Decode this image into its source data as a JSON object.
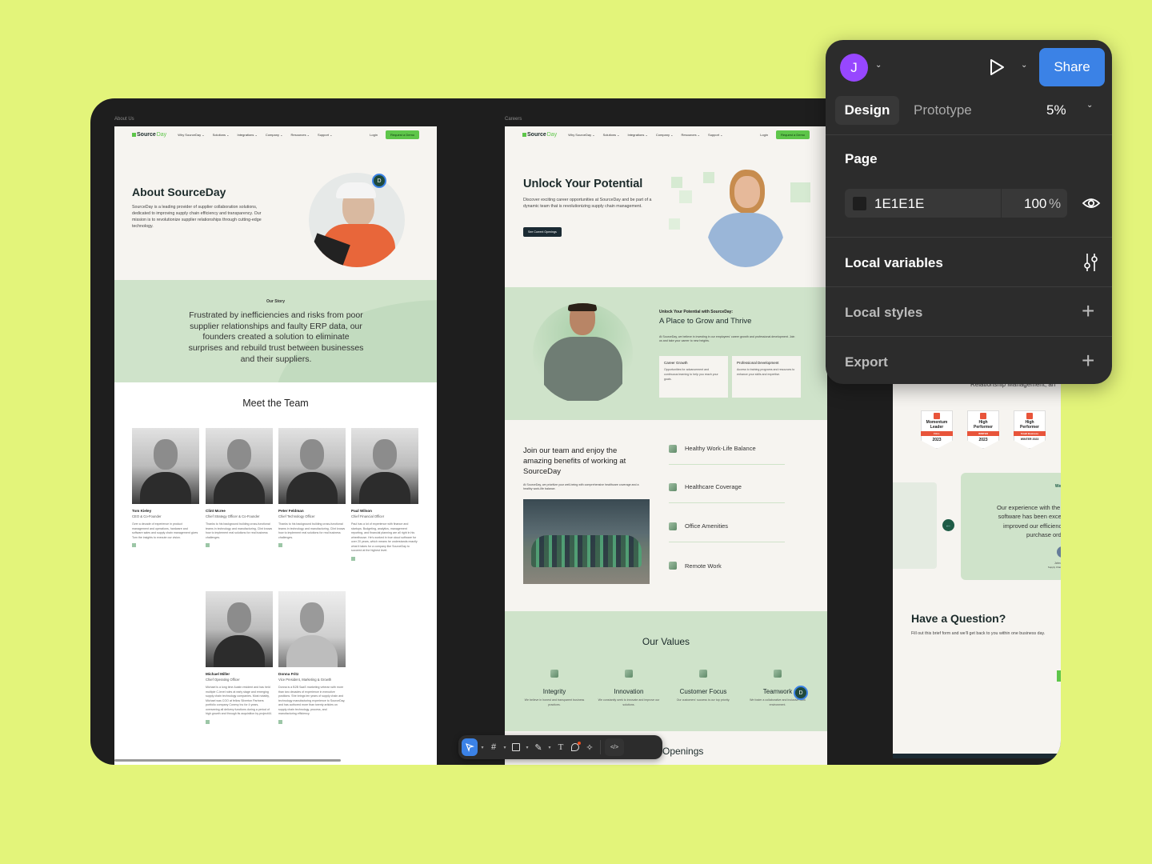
{
  "toolbar_panel": {
    "user_initial": "J",
    "share_label": "Share",
    "tabs": [
      {
        "label": "Design",
        "active": true
      },
      {
        "label": "Prototype",
        "active": false
      }
    ],
    "zoom": "5%",
    "page_section": {
      "title": "Page",
      "color_hex": "1E1E1E",
      "opacity": "100",
      "opacity_unit": "%"
    },
    "sections": [
      {
        "label": "Local variables"
      },
      {
        "label": "Local styles"
      },
      {
        "label": "Export"
      }
    ],
    "colors": {
      "share": "#3b82e6",
      "avatar": "#9747ff",
      "panel": "#2c2c2c"
    }
  },
  "frames": {
    "about": {
      "label": "About Us",
      "nav": {
        "logo_a": "Source",
        "logo_b": "Day",
        "items": [
          "Why SourceDay ⌄",
          "Solutions ⌄",
          "Integrations ⌄",
          "Company ⌄",
          "Resources ⌄",
          "Support ⌄"
        ],
        "login": "Login",
        "cta": "Request a Demo"
      },
      "hero": {
        "title": "About SourceDay",
        "body": "SourceDay is a leading provider of supplier collaboration solutions, dedicated to improving supply chain efficiency and transparency. Our mission is to revolutionize supplier relationships through cutting-edge technology."
      },
      "story": {
        "eyebrow": "Our Story",
        "body": "Frustrated by inefficiencies and risks from poor supplier relationships and faulty ERP data, our founders created a solution to eliminate surprises and rebuild trust between businesses and their suppliers."
      },
      "team": {
        "title": "Meet the Team",
        "members": [
          {
            "name": "Tom Kieley",
            "role": "CEO & Co-Founder",
            "bio": "Over a decade of experience in product management and operations, hardware and software sales and supply chain management gives Tom the insights to execute our vision."
          },
          {
            "name": "Clint Mcree",
            "role": "Chief Strategy Officer & Co-Founder",
            "bio": "Thanks to his background building cross-functional teams in technology and manufacturing, Clint knows how to implement real solutions for real business challenges."
          },
          {
            "name": "Peter Feldman",
            "role": "Chief Technology Officer",
            "bio": "Thanks to his background building cross-functional teams in technology and manufacturing, Clint knows how to implement real solutions for real business challenges."
          },
          {
            "name": "Paul Wilson",
            "role": "Chief Financial Officer",
            "bio": "Paul has a lot of experience with finance and startups. Budgeting, analytics, management reporting, and financial planning are all right in his wheelhouse. He's worked in true cloud software for over 20 years, which means he understands exactly what it takes for a company like SourceDay to succeed at the highest level."
          },
          {
            "name": "Michael Miller",
            "role": "Chief Operating Officer",
            "bio": "Michael is a long time Austin resident and has held multiple C-level roles at early stage and emerging supply chain technology companies. Most notably, Michael was COO at fellow Silverton Partners portfolio company Conexy Inc for 4 years, overseeing all delivery functions during a period of high growth and through its acquisition by project44."
          },
          {
            "name": "Donna Fritz",
            "role": "Vice President, Marketing & Growth",
            "bio": "Donna is a B2B SaaS marketing veteran with more than two decades of experience in executive positions. She brings ten years of supply chain and technology manufacturing experience to SourceDay, and has authored more than twenty articles on supply chain technology, process, and manufacturing efficiency."
          }
        ]
      },
      "collab_avatar": "D"
    },
    "careers": {
      "label": "Careers",
      "hero": {
        "title": "Unlock Your Potential",
        "body": "Discover exciting career opportunities at SourceDay and be part of a dynamic team that is revolutionizing supply chain management.",
        "cta": "See Current Openings"
      },
      "grow": {
        "eyebrow": "Unlock Your Potential with SourceDay:",
        "title": "A Place to Grow and Thrive",
        "body": "At SourceDay, we believe in investing in our employees' career growth and professional development. Join us and take your career to new heights.",
        "cards": [
          {
            "title": "Career Growth",
            "body": "Opportunities for advancement and continuous learning to help you reach your goals."
          },
          {
            "title": "Professional Development",
            "body": "Access to training programs and resources to enhance your skills and expertise."
          }
        ]
      },
      "benefits": {
        "title": "Join our team and enjoy the amazing benefits of working at SourceDay",
        "body": "At SourceDay, we prioritize your well-being with comprehensive healthcare coverage and a healthy work-life balance.",
        "items": [
          "Healthy Work-Life Balance",
          "Healthcare Coverage",
          "Office Amenities",
          "Remote Work"
        ]
      },
      "values": {
        "title": "Our Values",
        "items": [
          {
            "title": "Integrity",
            "body": "We believe in honest and transparent business practices."
          },
          {
            "title": "Innovation",
            "body": "We constantly seek to innovate and improve our solutions."
          },
          {
            "title": "Customer Focus",
            "body": "Our customers' success is our top priority."
          },
          {
            "title": "Teamwork",
            "body": "We foster a collaborative and inclusive work environment."
          }
        ]
      },
      "openings_title": "Openings",
      "collab_avatar": "D"
    },
    "home": {
      "partial_heading": "Relationship Management, an",
      "badges": [
        {
          "line1": "Momentum",
          "line2": "Leader",
          "ribbon": "FALL",
          "year": "2023"
        },
        {
          "line1": "High",
          "line2": "Performer",
          "ribbon": "WINTER",
          "year": "2023"
        },
        {
          "line1": "High",
          "line2": "Performer",
          "ribbon": "Small Business",
          "year": "WINTER 2023"
        }
      ],
      "testimonial": {
        "brand": "Webf",
        "quote": "Our experience with the k software has been excep improved our efficiency purchase orde",
        "author": "John Do",
        "author_role": "Supply Chain M"
      },
      "contact": {
        "title": "Have a Question?",
        "body": "Fill out this brief form and we'll get back to you within one business day."
      }
    }
  },
  "bottom_toolbar": {
    "tools": [
      "move",
      "frame",
      "rectangle",
      "pen",
      "text",
      "comment",
      "actions",
      "dev-mode"
    ],
    "active": "move"
  }
}
